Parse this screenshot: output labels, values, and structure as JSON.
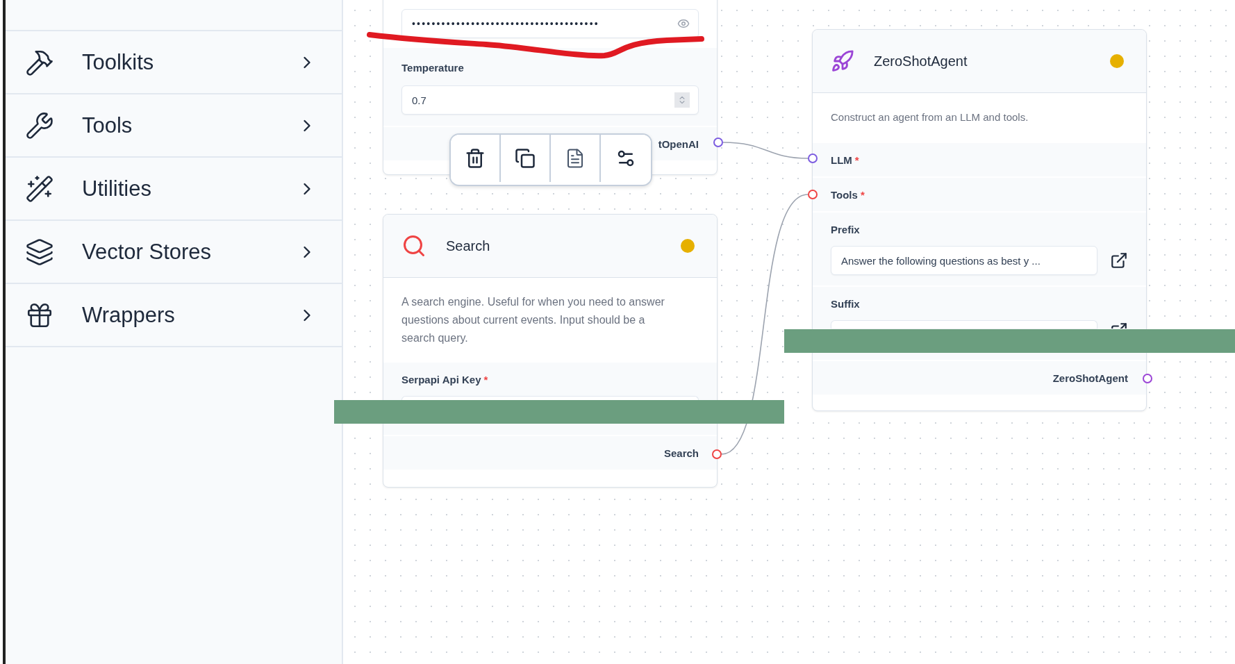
{
  "sidebar": {
    "items": [
      {
        "label": "Toolkits"
      },
      {
        "label": "Tools"
      },
      {
        "label": "Utilities"
      },
      {
        "label": "Vector Stores"
      },
      {
        "label": "Wrappers"
      }
    ]
  },
  "openai_node": {
    "api_key": {
      "value": "••••••••••••••••••••••••••••••••••••••"
    },
    "temperature": {
      "label": "Temperature",
      "value": "0.7"
    },
    "outputs": [
      {
        "label": "tOpenAI",
        "color": "#7c5ce0"
      }
    ]
  },
  "search_node": {
    "title": "Search",
    "description": "A search engine. Useful for when you need to answer questions about current events. Input should be a search query.",
    "fields": [
      {
        "label": "Serpapi Api Key",
        "mark": "*"
      }
    ],
    "outputs": [
      {
        "label": "Search",
        "color": "#ef4444"
      }
    ]
  },
  "agent_node": {
    "title": "ZeroShotAgent",
    "description": "Construct an agent from an LLM and tools.",
    "inputs": [
      {
        "label": "LLM",
        "mark": "*",
        "color": "#7c5ce0"
      },
      {
        "label": "Tools",
        "mark": "*",
        "color": "#ef4444"
      }
    ],
    "fields": [
      {
        "label": "Prefix",
        "value": "Answer the following questions as best y  ..."
      },
      {
        "label": "Suffix"
      }
    ],
    "outputs": [
      {
        "label": "ZeroShotAgent",
        "color": "#9b45d6"
      }
    ]
  }
}
